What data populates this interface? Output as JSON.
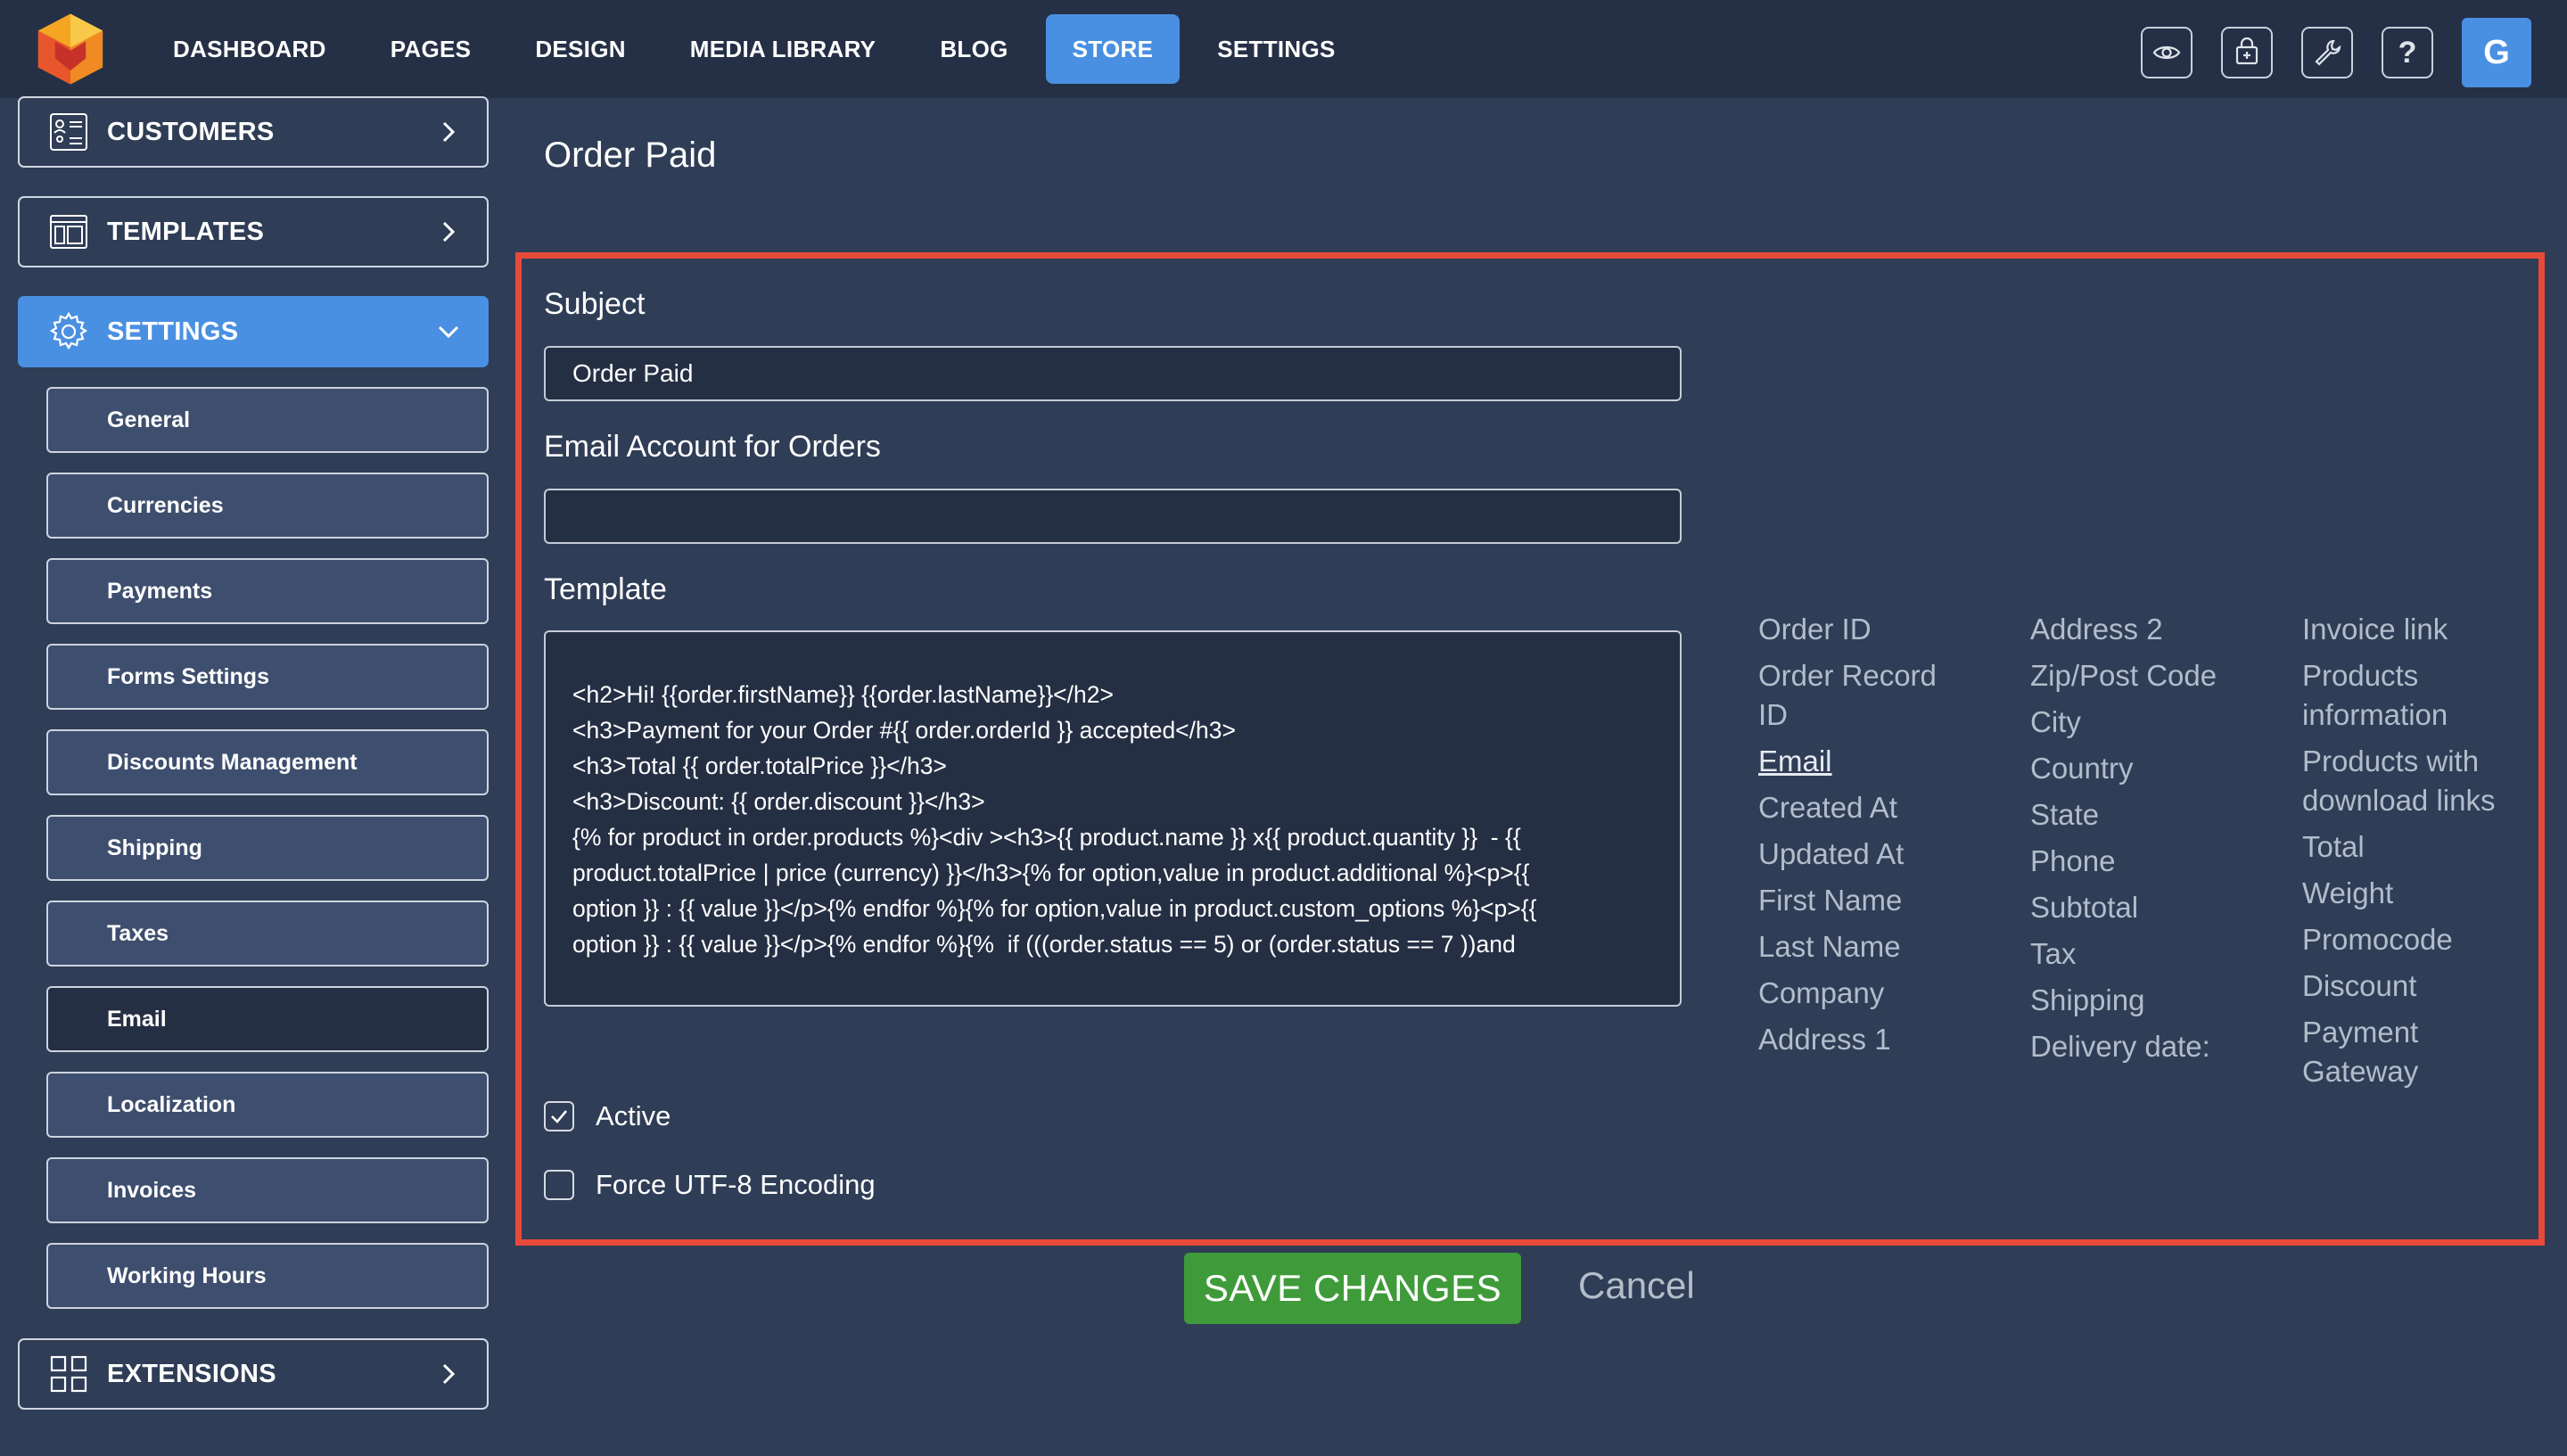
{
  "nav": {
    "items": [
      {
        "label": "DASHBOARD"
      },
      {
        "label": "PAGES"
      },
      {
        "label": "DESIGN"
      },
      {
        "label": "MEDIA LIBRARY"
      },
      {
        "label": "BLOG"
      },
      {
        "label": "STORE",
        "active": true
      },
      {
        "label": "SETTINGS"
      }
    ],
    "tools": [
      "eye-icon",
      "cart-icon",
      "wrench-icon",
      "help-icon"
    ],
    "help_label": "?",
    "avatar_initial": "G"
  },
  "sidebar": {
    "customers_label": "CUSTOMERS",
    "templates_label": "TEMPLATES",
    "settings_label": "SETTINGS",
    "extensions_label": "EXTENSIONS",
    "sub_items": [
      "General",
      "Currencies",
      "Payments",
      "Forms Settings",
      "Discounts Management",
      "Shipping",
      "Taxes",
      "Email",
      "Localization",
      "Invoices",
      "Working Hours"
    ],
    "active_sub": "Email"
  },
  "main": {
    "title": "Order Paid",
    "subject_label": "Subject",
    "subject_value": "Order Paid",
    "email_account_label": "Email Account for Orders",
    "email_account_value": "",
    "template_label": "Template",
    "template_lines": [
      "<h2>Hi! {{order.firstName}} {{order.lastName}}</h2>",
      "",
      "<h3>Payment for your Order #{{ order.orderId }} accepted</h3>",
      "<h3>Total {{ order.totalPrice }}</h3>",
      "<h3>Discount: {{ order.discount }}</h3>",
      "{% for product in order.products %}<div ><h3>{{ product.name }} x{{ product.quantity }}  - {{",
      "product.totalPrice | price (currency) }}</h3>{% for option,value in product.additional %}<p>{{",
      "option }} : {{ value }}</p>{% endfor %}{% for option,value in product.custom_options %}<p>{{",
      "option }} : {{ value }}</p>{% endfor %}{%  if (((order.status == 5) or (order.status == 7 ))and"
    ],
    "variables": {
      "col1": [
        "Order ID",
        "Order Record ID",
        "Email",
        "Created At",
        "Updated At",
        "First Name",
        "Last Name",
        "Company",
        "Address 1"
      ],
      "col2": [
        "Address 2",
        "Zip/Post Code",
        "City",
        "Country",
        "State",
        "Phone",
        "Subtotal",
        "Tax",
        "Shipping",
        "Delivery date:"
      ],
      "col3": [
        "Invoice link",
        "Products information",
        "Products with download links",
        "Total",
        "Weight",
        "Promocode",
        "Discount",
        "Payment Gateway"
      ]
    },
    "active_label": "Active",
    "active_checked": true,
    "utf8_label": "Force UTF-8 Encoding",
    "utf8_checked": false,
    "save_label": "SAVE CHANGES",
    "cancel_label": "Cancel"
  },
  "colors": {
    "accent": "#4a90e2",
    "save": "#3f9b3a",
    "highlight": "#e84a3a"
  }
}
